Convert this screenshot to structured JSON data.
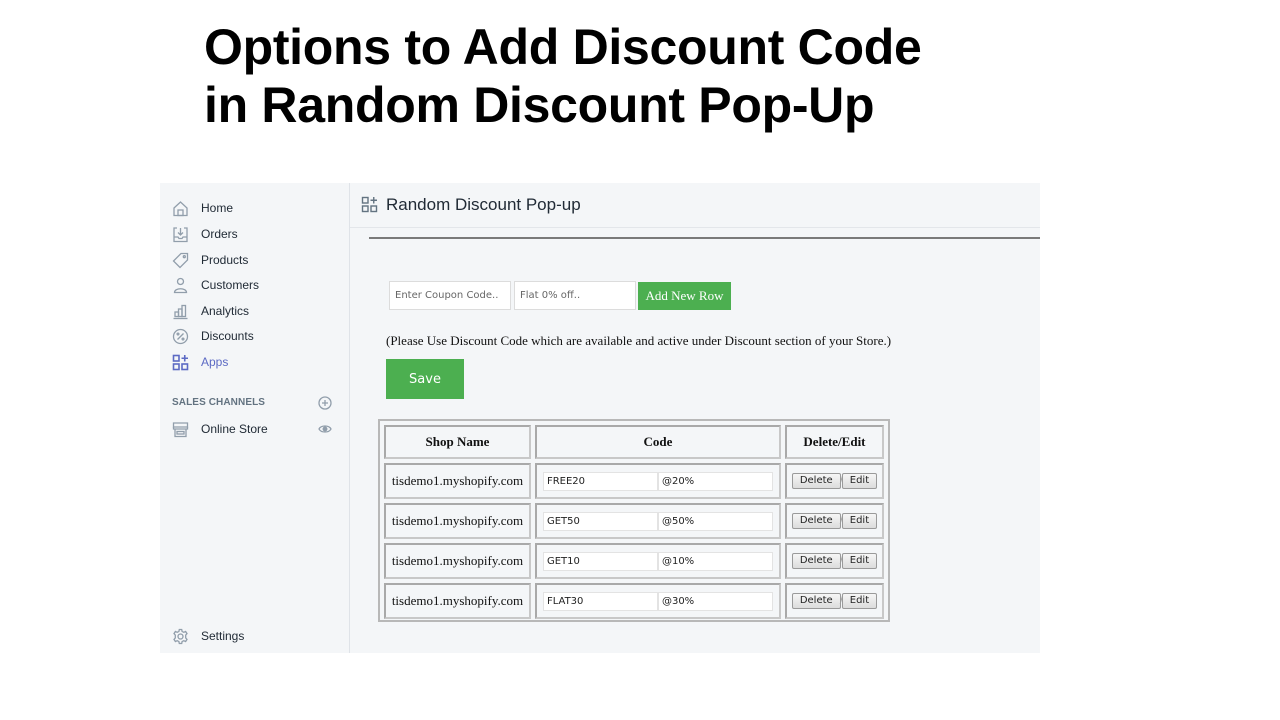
{
  "headline": {
    "line1": "Options to Add Discount Code",
    "line2": "in Random Discount Pop-Up"
  },
  "sidebar": {
    "items": [
      {
        "label": "Home",
        "icon": "home-icon"
      },
      {
        "label": "Orders",
        "icon": "orders-icon"
      },
      {
        "label": "Products",
        "icon": "tag-icon"
      },
      {
        "label": "Customers",
        "icon": "user-icon"
      },
      {
        "label": "Analytics",
        "icon": "bar-chart-icon"
      },
      {
        "label": "Discounts",
        "icon": "discount-icon"
      },
      {
        "label": "Apps",
        "icon": "apps-icon",
        "active": true
      }
    ],
    "sales_channels_title": "SALES CHANNELS",
    "online_store": "Online Store",
    "settings": "Settings"
  },
  "page": {
    "title": "Random Discount Pop-up"
  },
  "form": {
    "coupon_placeholder": "Enter Coupon Code..",
    "discount_placeholder": "Flat 0% off..",
    "add_row_label": "Add New Row",
    "note": "(Please Use Discount Code which are available and active under Discount section of your Store.)",
    "save_label": "Save"
  },
  "table": {
    "headers": [
      "Shop Name",
      "Code",
      "Delete/Edit"
    ],
    "delete_label": "Delete",
    "edit_label": "Edit",
    "separator": "/",
    "rows": [
      {
        "shop": "tisdemo1.myshopify.com",
        "code": "FREE20",
        "value": "@20%"
      },
      {
        "shop": "tisdemo1.myshopify.com",
        "code": "GET50",
        "value": "@50%"
      },
      {
        "shop": "tisdemo1.myshopify.com",
        "code": "GET10",
        "value": "@10%"
      },
      {
        "shop": "tisdemo1.myshopify.com",
        "code": "FLAT30",
        "value": "@30%"
      }
    ]
  },
  "colors": {
    "accent_green": "#4caf50",
    "active_nav": "#5c6ac4",
    "app_bg": "#f4f6f8"
  }
}
